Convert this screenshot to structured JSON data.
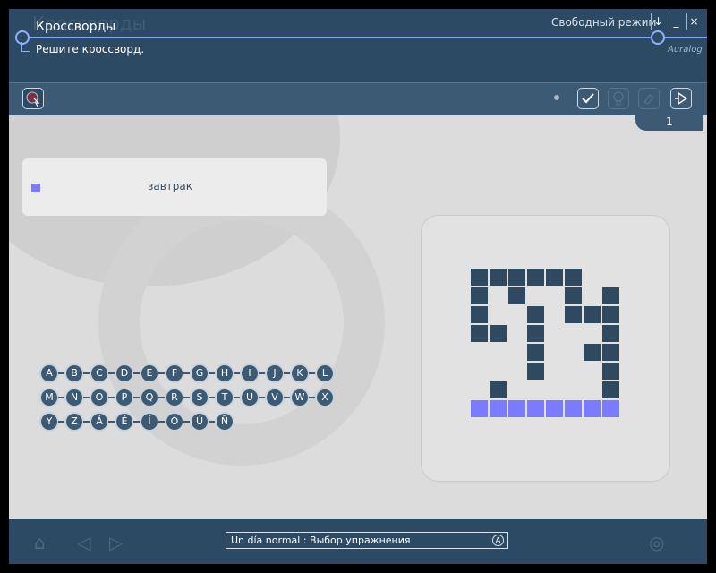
{
  "header": {
    "ghost_title": "Кроссворды",
    "title": "Кроссворды",
    "subtitle": "Решите кроссворд.",
    "mode": "Свободный режим",
    "buttons": [
      "↓",
      "_",
      "×"
    ],
    "logo": "Auralog"
  },
  "toolbar": {
    "check_symbol": "✓",
    "next_symbol": "▷",
    "page_number": "1"
  },
  "clue": {
    "text": "завтрак"
  },
  "keyboard": {
    "rows": [
      [
        "A",
        "B",
        "C",
        "D",
        "E",
        "F",
        "G",
        "H",
        "I",
        "J",
        "K",
        "L"
      ],
      [
        "M",
        "N",
        "O",
        "P",
        "Q",
        "R",
        "S",
        "T",
        "U",
        "V",
        "W",
        "X"
      ],
      [
        "Y",
        "Z",
        "Á",
        "É",
        "Í",
        "Ó",
        "Ú",
        "Ñ"
      ]
    ]
  },
  "crossword": {
    "rows": 8,
    "cols": 8,
    "filled": [
      [
        0,
        0
      ],
      [
        0,
        1
      ],
      [
        0,
        2
      ],
      [
        0,
        3
      ],
      [
        0,
        4
      ],
      [
        0,
        5
      ],
      [
        1,
        0
      ],
      [
        1,
        2
      ],
      [
        1,
        5
      ],
      [
        1,
        7
      ],
      [
        2,
        0
      ],
      [
        2,
        3
      ],
      [
        2,
        5
      ],
      [
        2,
        6
      ],
      [
        2,
        7
      ],
      [
        3,
        0
      ],
      [
        3,
        1
      ],
      [
        3,
        3
      ],
      [
        3,
        7
      ],
      [
        4,
        3
      ],
      [
        4,
        6
      ],
      [
        4,
        7
      ],
      [
        5,
        3
      ],
      [
        5,
        7
      ],
      [
        6,
        1
      ],
      [
        6,
        7
      ]
    ],
    "highlighted": [
      [
        7,
        0
      ],
      [
        7,
        1
      ],
      [
        7,
        2
      ],
      [
        7,
        3
      ],
      [
        7,
        4
      ],
      [
        7,
        5
      ],
      [
        7,
        6
      ],
      [
        7,
        7
      ]
    ],
    "colors": {
      "cell": "#2f4a60",
      "highlight": "#7b7bff"
    }
  },
  "footer": {
    "lesson_label": "Un día normal : Выбор упражнения",
    "lesson_icon": "A"
  }
}
